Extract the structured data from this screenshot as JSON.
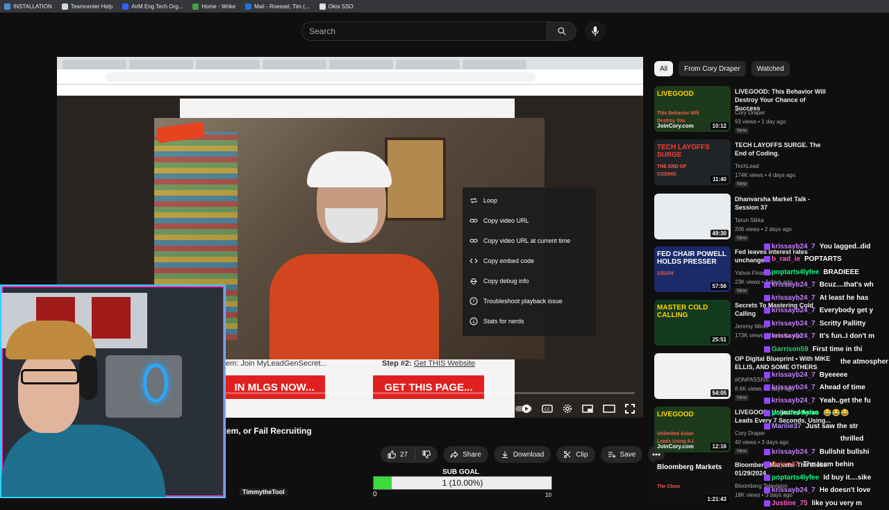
{
  "bookmarks": [
    {
      "label": "INSTALLATION",
      "color": "#4a90d9"
    },
    {
      "label": "Teamcenter Help",
      "color": "#cfd8dc"
    },
    {
      "label": "AirM Eng Tech Org...",
      "color": "#2962ff"
    },
    {
      "label": "Home - Wrike",
      "color": "#43a047"
    },
    {
      "label": "Mail - Roessel, Tim (...",
      "color": "#1976d2"
    },
    {
      "label": "Okta SSO",
      "color": "#e0e0e0"
    }
  ],
  "search": {
    "placeholder": "Search"
  },
  "context_menu": [
    {
      "label": "Loop",
      "icon": "loop-icon"
    },
    {
      "label": "Copy video URL",
      "icon": "link-icon"
    },
    {
      "label": "Copy video URL at current time",
      "icon": "link-icon"
    },
    {
      "label": "Copy embed code",
      "icon": "embed-icon"
    },
    {
      "label": "Copy debug info",
      "icon": "debug-icon"
    },
    {
      "label": "Troubleshoot playback issue",
      "icon": "help-icon"
    },
    {
      "label": "Stats for nerds",
      "icon": "info-icon"
    }
  ],
  "inner_page": {
    "step1": "tem: Join MyLeadGenSecret...",
    "step2_prefix": "Step #2:",
    "step2_link": "Get THIS Website",
    "cta1": "IN MLGS NOW...",
    "cta2": "GET THIS PAGE..."
  },
  "video": {
    "title": "tem, or Fail Recruiting",
    "likes": "27",
    "share": "Share",
    "download": "Download",
    "clip": "Clip",
    "save": "Save"
  },
  "sub_goal": {
    "label": "SUB GOAL",
    "text": "1 (10.00%)",
    "progress": 0.1,
    "min": "0",
    "max": "10",
    "streamer_tag": "TimmytheTool"
  },
  "chips": [
    {
      "label": "All",
      "active": true
    },
    {
      "label": "From Cory Draper",
      "active": false
    },
    {
      "label": "Watched",
      "active": false
    }
  ],
  "recommendations": [
    {
      "title": "LIVEGOOD: This Behavior Will Destroy Your Chance of Success",
      "channel": "Cory Draper",
      "meta": "93 views • 1 day ago",
      "badge": "New",
      "duration": "10:12",
      "thumb_text": "LIVEGOOD",
      "thumb_sub": "This Behavior Will Destroy You",
      "thumb_foot": "JoinCory.com",
      "thumb_color": "#1d3a1d",
      "accent": "#ffd400"
    },
    {
      "title": "TECH LAYOFFS SURGE. The End of Coding.",
      "channel": "TechLead",
      "meta": "174K views • 4 days ago",
      "badge": "New",
      "duration": "11:40",
      "thumb_text": "TECH LAYOFFS SURGE",
      "thumb_sub": "THE END OF CODING",
      "thumb_foot": "",
      "thumb_color": "#202428",
      "accent": "#ff3b30"
    },
    {
      "title": "Dhanvarsha Market Talk - Session 37",
      "channel": "Tarun Sikka",
      "meta": "206 views • 2 days ago",
      "badge": "New",
      "duration": "49:30",
      "thumb_text": "",
      "thumb_sub": "",
      "thumb_foot": "",
      "thumb_color": "#e8ecef",
      "accent": "#0a74c9"
    },
    {
      "title": "Fed leaves interest rates unchanged",
      "channel": "Yahoo Finance",
      "meta": "23K views • 3 days ago",
      "badge": "New",
      "duration": "57:56",
      "thumb_text": "FED CHAIR POWELL HOLDS PRESSER",
      "thumb_sub": "1/31/24",
      "thumb_foot": "",
      "thumb_color": "#1b2b6a",
      "accent": "#ffffff"
    },
    {
      "title": "Secrets To Mastering Cold Calling",
      "channel": "Jeremy Miner",
      "meta": "173K views • 3 months ago",
      "badge": "",
      "duration": "25:51",
      "thumb_text": "MASTER COLD CALLING",
      "thumb_sub": "",
      "thumb_foot": "",
      "thumb_color": "#123a1e",
      "accent": "#ffd400"
    },
    {
      "title": "OP Digital Blueprint • With MIKE ELLIS, AND SOME OTHERS",
      "channel": "#ONPASSIVE",
      "meta": "8.6K views • 2 days ago",
      "badge": "New",
      "duration": "54:05",
      "thumb_text": "",
      "thumb_sub": "",
      "thumb_foot": "",
      "thumb_color": "#f2f2f2",
      "accent": "#1a73e8"
    },
    {
      "title": "LIVEGOOD: Unlimited Asian Leads Every 7 Seconds, Using...",
      "channel": "Cory Draper",
      "meta": "40 views • 3 days ago",
      "badge": "New",
      "duration": "12:16",
      "thumb_text": "LIVEGOOD",
      "thumb_sub": "Unlimited Asian Leads Using A.I.",
      "thumb_foot": "JoinCory.com",
      "thumb_color": "#1d3a1d",
      "accent": "#ffd400"
    },
    {
      "title": "Bloomberg Markets: The Close 01/29/2024",
      "channel": "Bloomberg Television",
      "meta": "18K views • 3 days ago",
      "badge": "",
      "duration": "1:21:43",
      "thumb_text": "Bloomberg Markets",
      "thumb_sub": "The Close",
      "thumb_foot": "",
      "thumb_color": "#111111",
      "accent": "#ffffff"
    }
  ],
  "chat": [
    {
      "user": "krissayb24_7",
      "color": "#c77dff",
      "msg": "You lagged..did"
    },
    {
      "user": "b_rad_ie",
      "color": "#ff5ec4",
      "msg": "POPTARTS"
    },
    {
      "user": "poptarts4lyfee",
      "color": "#00ff7f",
      "msg": "BRADIEEE"
    },
    {
      "user": "krissayb24_7",
      "color": "#c77dff",
      "msg": "Bcuz....that's wh"
    },
    {
      "user": "krissayb24_7",
      "color": "#c77dff",
      "msg": "At least he has"
    },
    {
      "user": "krissayb24_7",
      "color": "#c77dff",
      "msg": "Everybody get y"
    },
    {
      "user": "krissayb24_7",
      "color": "#c77dff",
      "msg": "Scritty Pallitty"
    },
    {
      "user": "krissayb24_7",
      "color": "#c77dff",
      "msg": "It's fun..I don't m"
    },
    {
      "user": "Garrison59",
      "color": "#2ecc71",
      "msg": "First time in thi"
    },
    {
      "user": "",
      "color": "#ffffff",
      "msg": "the atmospher"
    },
    {
      "user": "krissayb24_7",
      "color": "#c77dff",
      "msg": "Byeeeee"
    },
    {
      "user": "krissayb24_7",
      "color": "#c77dff",
      "msg": "Ahead of time"
    },
    {
      "user": "krissayb24_7",
      "color": "#c77dff",
      "msg": "Yeah..get the fu"
    },
    {
      "user": "poptarts4lyfee",
      "color": "#00ff7f",
      "msg": "😂😂😂"
    },
    {
      "user": "Marilie37",
      "color": "#b28cff",
      "msg": "Just saw the str"
    },
    {
      "user": "",
      "color": "#ffffff",
      "msg": "thrilled"
    },
    {
      "user": "krissayb24_7",
      "color": "#c77dff",
      "msg": "Bullshit bullshi"
    },
    {
      "user": "Dejon47",
      "color": "#ff4d4d",
      "msg": "The team behin"
    },
    {
      "user": "poptarts4lyfee",
      "color": "#00ff7f",
      "msg": "Id buy it....sike"
    },
    {
      "user": "krissayb24_7",
      "color": "#c77dff",
      "msg": "He doesn't love"
    },
    {
      "user": "Justine_75",
      "color": "#ff5ec4",
      "msg": "like you very m"
    }
  ]
}
